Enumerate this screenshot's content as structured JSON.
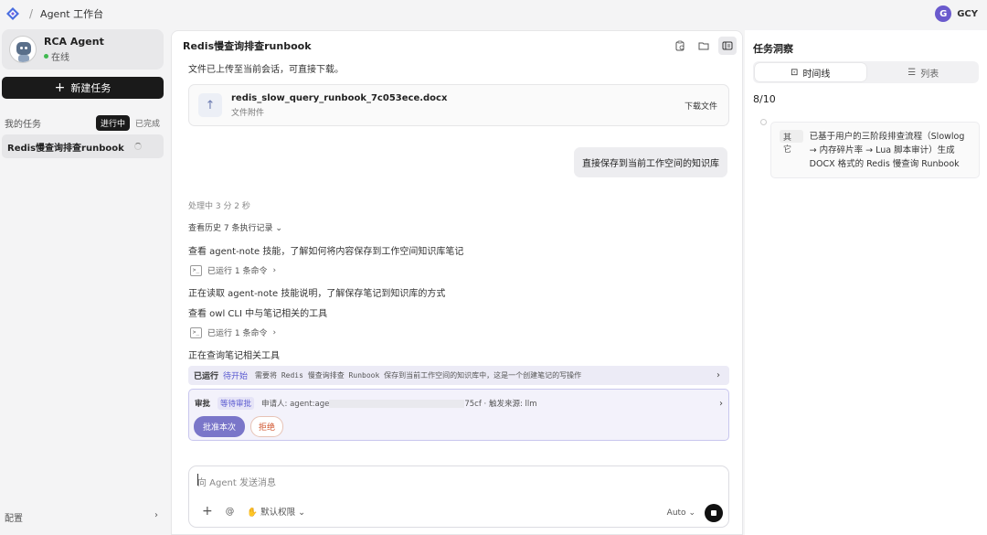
{
  "topbar": {
    "separator": "/",
    "workspace_title": "Agent 工作台",
    "user_initial": "G",
    "user_name": "GCY"
  },
  "colors": {
    "accent": "#6a5acd",
    "approve": "#7a76c9",
    "reject": "#d0552e",
    "online": "#3fb950",
    "dark": "#1a1a1a"
  },
  "sidebar": {
    "agent_name": "RCA Agent",
    "agent_status": "在线",
    "new_task_label": "新建任务",
    "my_tasks_label": "我的任务",
    "tab_active": "进行中",
    "tab_done": "已完成",
    "task_item": "Redis慢查询排查runbook",
    "config_label": "配置"
  },
  "main": {
    "title": "Redis慢查询排查runbook",
    "upload_note": "文件已上传至当前会话，可直接下载。",
    "file": {
      "name": "redis_slow_query_runbook_7c053ece.docx",
      "sub": "文件附件",
      "download": "下载文件"
    },
    "user_message": "直接保存到当前工作空间的知识库",
    "processing": "处理中 3 分 2 秒",
    "history": "查看历史 7 条执行记录",
    "step1": "查看 agent-note 技能，了解如何将内容保存到工作空间知识库笔记",
    "cmd1": "已运行 1 条命令",
    "step2": "正在读取 agent-note 技能说明，了解保存笔记到知识库的方式",
    "step3": "查看 owl CLI 中与笔记相关的工具",
    "cmd2": "已运行 1 条命令",
    "step4": "正在查询笔记相关工具",
    "run_bar": {
      "label": "已运行",
      "status": "待开始",
      "desc": "需要将 Redis 慢查询排查 Runbook 保存到当前工作空间的知识库中，这是一个创建笔记的写操作"
    },
    "approval": {
      "label": "审批",
      "status": "等待审批",
      "requester": "申请人: agent:age",
      "tail": "75cf · 触发来源: llm",
      "approve": "批准本次",
      "reject": "拒绝"
    },
    "composer": {
      "placeholder": "向 Agent 发送消息",
      "permission": "默认权限",
      "model": "Auto",
      "at": "@"
    }
  },
  "rpanel": {
    "title": "任务洞察",
    "tab_timeline": "时间线",
    "tab_list": "列表",
    "progress": "8/10",
    "item_tag": "其它",
    "item_text": "已基于用户的三阶段排查流程（Slowlog → 内存碎片率 → Lua 脚本审计）生成 DOCX 格式的 Redis 慢查询 Runbook"
  }
}
